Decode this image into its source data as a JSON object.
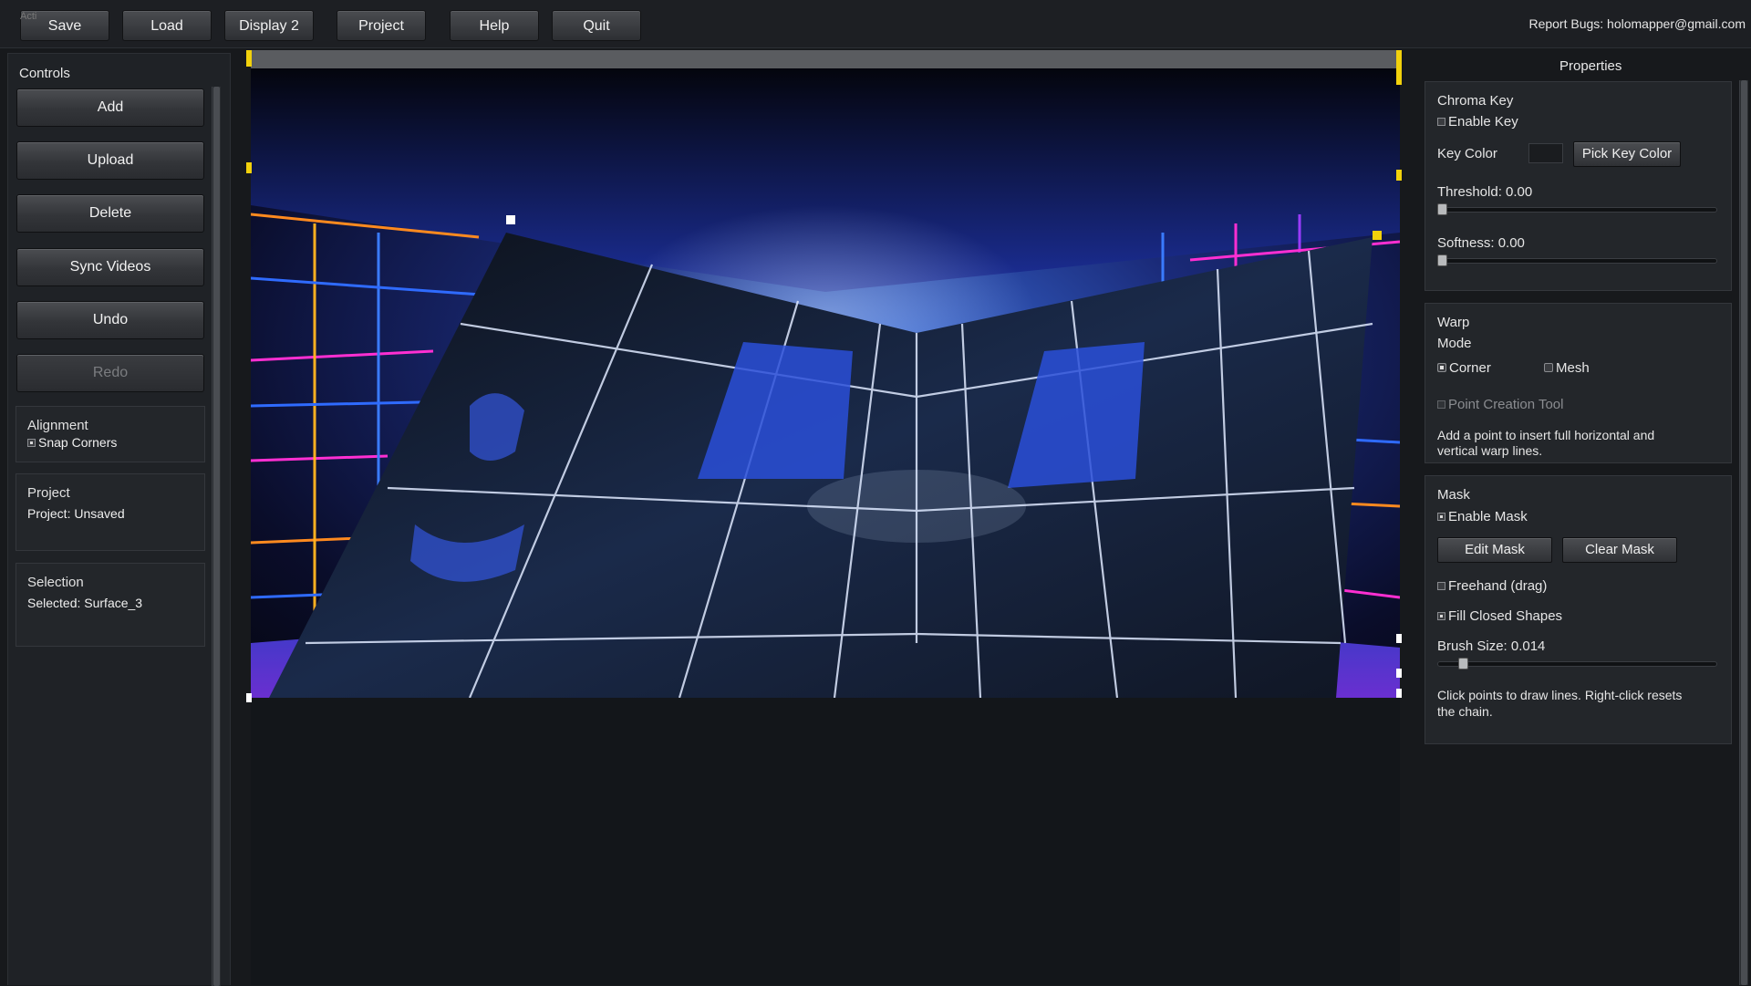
{
  "toolbar": {
    "ghost_label": "Acti",
    "buttons": [
      "Save",
      "Load",
      "Display 2",
      "Project",
      "Help",
      "Quit"
    ],
    "report": "Report Bugs: holomapper@gmail.com"
  },
  "controls": {
    "title": "Controls",
    "buttons": [
      "Add",
      "Upload",
      "Delete",
      "Sync Videos",
      "Undo",
      "Redo"
    ],
    "alignment": {
      "title": "Alignment",
      "snap_corners": "Snap Corners",
      "snap_checked": true
    },
    "project": {
      "title": "Project",
      "status": "Project: Unsaved"
    },
    "selection": {
      "title": "Selection",
      "selected": "Selected: Surface_3"
    }
  },
  "properties": {
    "title": "Properties",
    "chroma": {
      "title": "Chroma Key",
      "enable_key": "Enable Key",
      "enable_checked": false,
      "key_color_label": "Key Color",
      "key_color": "#1a1c1f",
      "pick_button": "Pick Key Color",
      "threshold_label": "Threshold: 0.00",
      "threshold_value": 0.0,
      "softness_label": "Softness: 0.00",
      "softness_value": 0.0
    },
    "warp": {
      "title": "Warp",
      "mode_label": "Mode",
      "corner": "Corner",
      "mesh": "Mesh",
      "selected_mode": "Corner",
      "point_tool": "Point Creation Tool",
      "hint_line1": "Add a point to insert full horizontal and",
      "hint_line2": "vertical warp lines."
    },
    "mask": {
      "title": "Mask",
      "enable_mask": "Enable Mask",
      "enable_checked": true,
      "edit_button": "Edit Mask",
      "clear_button": "Clear Mask",
      "freehand": "Freehand (drag)",
      "freehand_checked": false,
      "fill_closed": "Fill Closed Shapes",
      "fill_checked": true,
      "brush_label": "Brush Size: 0.014",
      "brush_value": 0.014,
      "hint_line1": "Click points to draw lines. Right-click resets",
      "hint_line2": "the chain."
    }
  },
  "colors": {
    "handle_yellow": "#f2d10c",
    "handle_white": "#ffffff",
    "neon_blue": "#2f6bff",
    "neon_magenta": "#ff2fd2",
    "neon_orange": "#ff8a1f"
  }
}
